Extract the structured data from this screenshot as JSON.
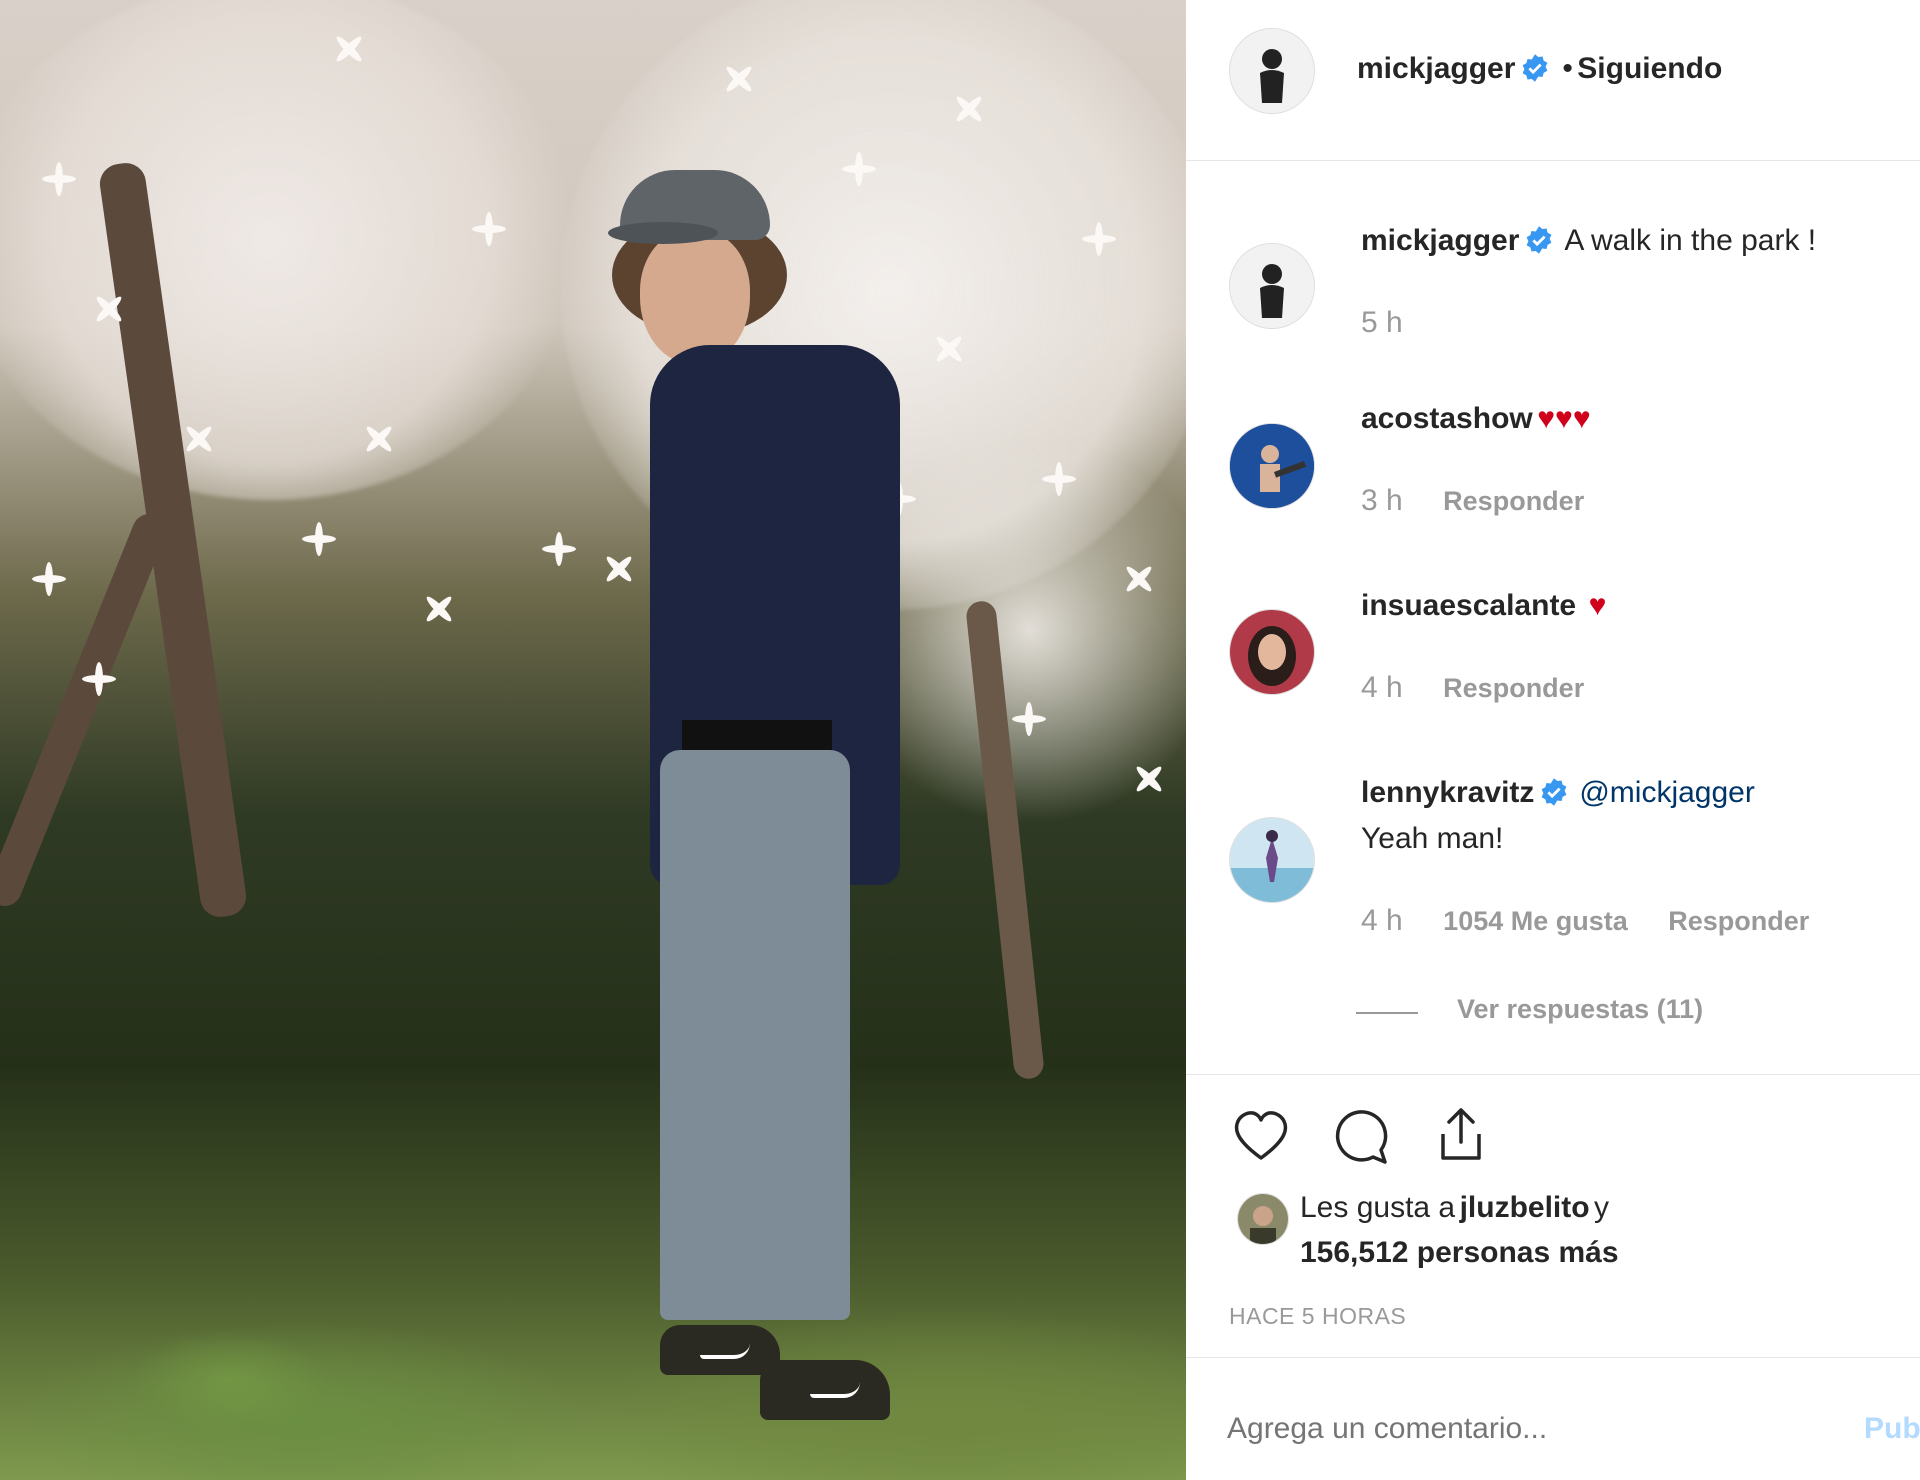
{
  "post": {
    "header": {
      "username": "mickjagger",
      "separator": "•",
      "follow_status": "Siguiendo"
    },
    "caption": {
      "username": "mickjagger",
      "text": "A walk in the park !",
      "time": "5 h"
    },
    "comments": [
      {
        "username": "acostashow",
        "text": "",
        "time": "3 h",
        "reply": "Responder",
        "hearts": "♥♥♥"
      },
      {
        "username": "insuaescalante",
        "text": "",
        "time": "4 h",
        "reply": "Responder",
        "hearts": "♥"
      },
      {
        "username": "lennykravitz",
        "mention": "@mickjagger",
        "text": "Yeah man!",
        "time": "4 h",
        "likes": "1054 Me gusta",
        "reply": "Responder",
        "view_replies": "Ver respuestas (11)"
      }
    ],
    "likes": {
      "prefix": "Les gusta a",
      "user": "jluzbelito",
      "connector": "y",
      "count": "156,512 personas más"
    },
    "timestamp": "HACE 5 HORAS",
    "comment_box": {
      "placeholder": "Agrega un comentario...",
      "publish": "Publicar"
    }
  },
  "colors": {
    "verified": "#3897f0",
    "heart": "#d0021b",
    "muted": "#999999",
    "link": "#003569"
  },
  "icons": [
    "heart-outline-icon",
    "comment-icon",
    "share-icon",
    "verified-badge-icon"
  ]
}
